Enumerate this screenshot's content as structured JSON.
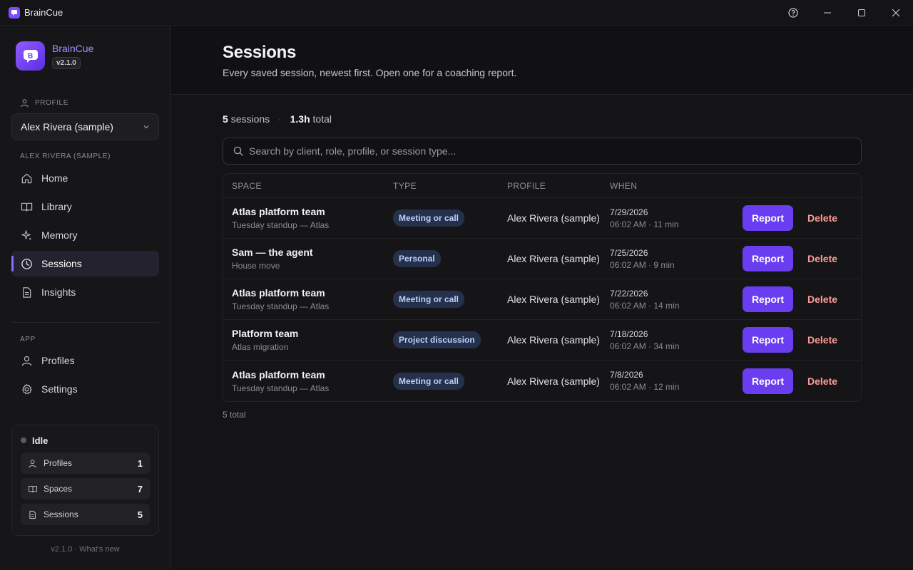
{
  "window": {
    "title": "BrainCue"
  },
  "brand": {
    "name": "BrainCue",
    "version": "v2.1.0"
  },
  "profile": {
    "section_label": "PROFILE",
    "selected": "Alex Rivera (sample)",
    "nav_label": "ALEX RIVERA (SAMPLE)"
  },
  "nav": [
    {
      "label": "Home",
      "icon": "home-icon"
    },
    {
      "label": "Library",
      "icon": "book-icon"
    },
    {
      "label": "Memory",
      "icon": "sparkle-icon"
    },
    {
      "label": "Sessions",
      "icon": "clock-icon",
      "active": true
    },
    {
      "label": "Insights",
      "icon": "document-icon"
    }
  ],
  "app": {
    "section_label": "APP",
    "items": [
      {
        "label": "Profiles",
        "icon": "user-icon"
      },
      {
        "label": "Settings",
        "icon": "gear-icon"
      }
    ]
  },
  "status": {
    "state": "Idle",
    "stats": [
      {
        "label": "Profiles",
        "count": "1",
        "icon": "user-icon"
      },
      {
        "label": "Spaces",
        "count": "7",
        "icon": "book-icon"
      },
      {
        "label": "Sessions",
        "count": "5",
        "icon": "document-icon"
      }
    ]
  },
  "footer": {
    "text": "v2.1.0 · What's new"
  },
  "page": {
    "title": "Sessions",
    "subtitle": "Every saved session, newest first. Open one for a coaching report."
  },
  "summary": {
    "sessions_count": "5",
    "sessions_label": "sessions",
    "separator": "·",
    "total_hours": "1.3h",
    "total_label": "total"
  },
  "search": {
    "placeholder": "Search by client, role, profile, or session type..."
  },
  "table": {
    "columns": {
      "space": "SPACE",
      "type": "TYPE",
      "profile": "PROFILE",
      "when": "WHEN"
    },
    "rows": [
      {
        "space": "Atlas platform team",
        "sub": "Tuesday standup — Atlas",
        "type": "Meeting or call",
        "profile": "Alex Rivera (sample)",
        "date": "7/29/2026",
        "time": "06:02 AM · 11 min"
      },
      {
        "space": "Sam — the agent",
        "sub": "House move",
        "type": "Personal",
        "profile": "Alex Rivera (sample)",
        "date": "7/25/2026",
        "time": "06:02 AM · 9 min"
      },
      {
        "space": "Atlas platform team",
        "sub": "Tuesday standup — Atlas",
        "type": "Meeting or call",
        "profile": "Alex Rivera (sample)",
        "date": "7/22/2026",
        "time": "06:02 AM · 14 min"
      },
      {
        "space": "Platform team",
        "sub": "Atlas migration",
        "type": "Project discussion",
        "profile": "Alex Rivera (sample)",
        "date": "7/18/2026",
        "time": "06:02 AM · 34 min"
      },
      {
        "space": "Atlas platform team",
        "sub": "Tuesday standup — Atlas",
        "type": "Meeting or call",
        "profile": "Alex Rivera (sample)",
        "date": "7/8/2026",
        "time": "06:02 AM · 12 min"
      }
    ],
    "report_label": "Report",
    "delete_label": "Delete"
  },
  "total_footer": "5 total"
}
